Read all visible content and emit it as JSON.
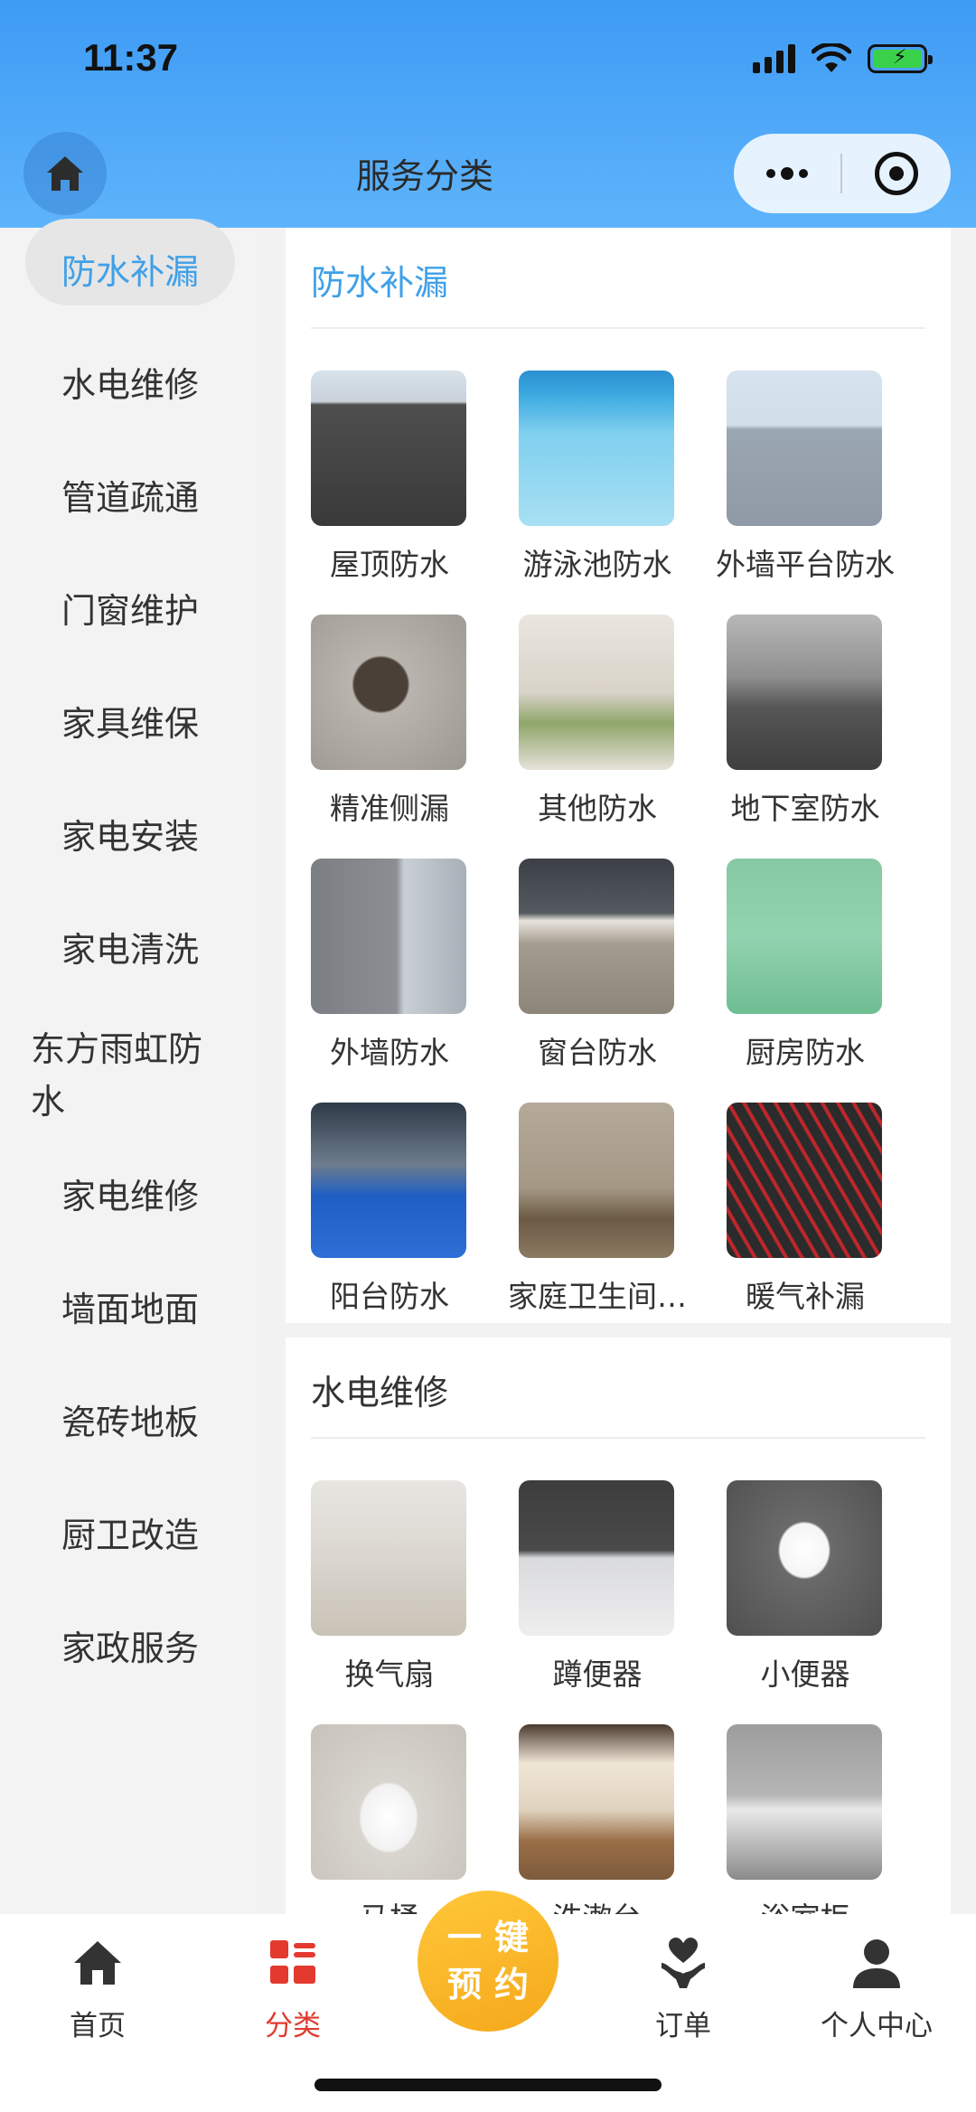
{
  "status_bar": {
    "time": "11:37"
  },
  "nav": {
    "title": "服务分类"
  },
  "sidebar": {
    "items": [
      {
        "label": "防水补漏",
        "active": true
      },
      {
        "label": "水电维修"
      },
      {
        "label": "管道疏通"
      },
      {
        "label": "门窗维护"
      },
      {
        "label": "家具维保"
      },
      {
        "label": "家电安装"
      },
      {
        "label": "家电清洗"
      },
      {
        "label": "东方雨虹防水"
      },
      {
        "label": "家电维修"
      },
      {
        "label": "墙面地面"
      },
      {
        "label": "瓷砖地板"
      },
      {
        "label": "厨卫改造"
      },
      {
        "label": "家政服务"
      }
    ]
  },
  "sections": [
    {
      "title": "防水补漏",
      "items": [
        {
          "label": "屋顶防水"
        },
        {
          "label": "游泳池防水"
        },
        {
          "label": "外墙平台防水"
        },
        {
          "label": "精准侧漏"
        },
        {
          "label": "其他防水"
        },
        {
          "label": "地下室防水"
        },
        {
          "label": "外墙防水"
        },
        {
          "label": "窗台防水"
        },
        {
          "label": "厨房防水"
        },
        {
          "label": "阳台防水"
        },
        {
          "label": "家庭卫生间…"
        },
        {
          "label": "暖气补漏"
        }
      ]
    },
    {
      "title": "水电维修",
      "items": [
        {
          "label": "换气扇"
        },
        {
          "label": "蹲便器"
        },
        {
          "label": "小便器"
        },
        {
          "label": "马桶"
        },
        {
          "label": "洗漱台"
        },
        {
          "label": "浴室柜"
        }
      ]
    }
  ],
  "tabbar": {
    "home": "首页",
    "category": "分类",
    "book_line1": "一键",
    "book_line2": "预约",
    "orders": "订单",
    "profile": "个人中心",
    "active_color": "#e33a2f",
    "book_color": "#f5a81a"
  },
  "colors": {
    "header": "#4aa7f8",
    "sidebar_active_text": "#3fa0e8"
  }
}
